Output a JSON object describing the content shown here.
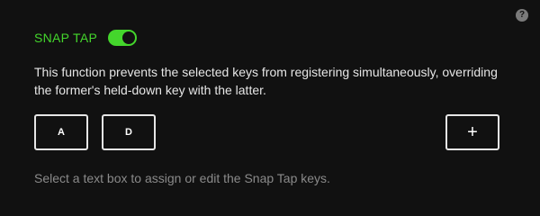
{
  "help": {
    "icon": "question-icon",
    "glyph": "?"
  },
  "header": {
    "title": "SNAP TAP",
    "toggle_on": true
  },
  "description": "This function prevents the selected keys from registering simultaneously, overriding the former's held-down key with the latter.",
  "keys": [
    {
      "label": "A"
    },
    {
      "label": "D"
    }
  ],
  "add_button": {
    "glyph": "+"
  },
  "hint": "Select a text box to assign or edit the Snap Tap keys.",
  "colors": {
    "accent": "#44d62c",
    "background": "#111111",
    "text": "#e6e6e6",
    "muted": "#8a8a8a"
  }
}
